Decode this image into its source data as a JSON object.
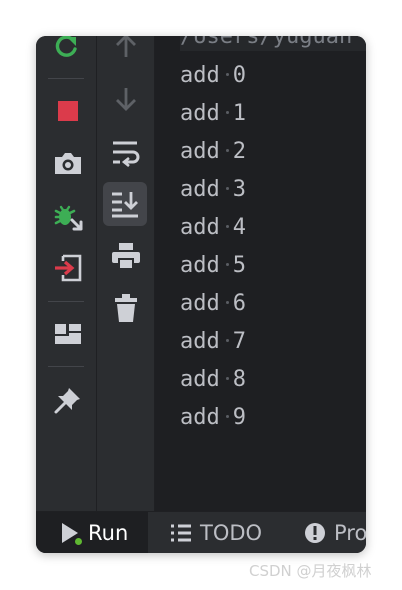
{
  "toolbar": {
    "rerun_icon": "rerun-icon",
    "stop_icon": "stop-icon",
    "screenshot_icon": "camera-icon",
    "debug_icon": "debug-icon",
    "exit_icon": "exit-icon",
    "layout_icon": "layout-icon",
    "pin_icon": "pin-icon",
    "colors": {
      "rerun": "#3dae55",
      "stop": "#db3b4b",
      "debug": "#3dae55",
      "exit": "#db3b4b"
    }
  },
  "scroll_toolbar": {
    "up_icon": "arrow-up-icon",
    "down_icon": "arrow-down-icon",
    "wrap_icon": "soft-wrap-icon",
    "scroll_end_icon": "scroll-to-end-icon",
    "print_icon": "print-icon",
    "trash_icon": "trash-icon"
  },
  "console": {
    "command": "/Users/yuguan",
    "lines": [
      {
        "word": "add",
        "num": "0"
      },
      {
        "word": "add",
        "num": "1"
      },
      {
        "word": "add",
        "num": "2"
      },
      {
        "word": "add",
        "num": "3"
      },
      {
        "word": "add",
        "num": "4"
      },
      {
        "word": "add",
        "num": "5"
      },
      {
        "word": "add",
        "num": "6"
      },
      {
        "word": "add",
        "num": "7"
      },
      {
        "word": "add",
        "num": "8"
      },
      {
        "word": "add",
        "num": "9"
      }
    ]
  },
  "bottom_bar": {
    "run_label": "Run",
    "todo_label": "TODO",
    "problems_label": "Pro"
  },
  "watermark": "CSDN @月夜枫林"
}
